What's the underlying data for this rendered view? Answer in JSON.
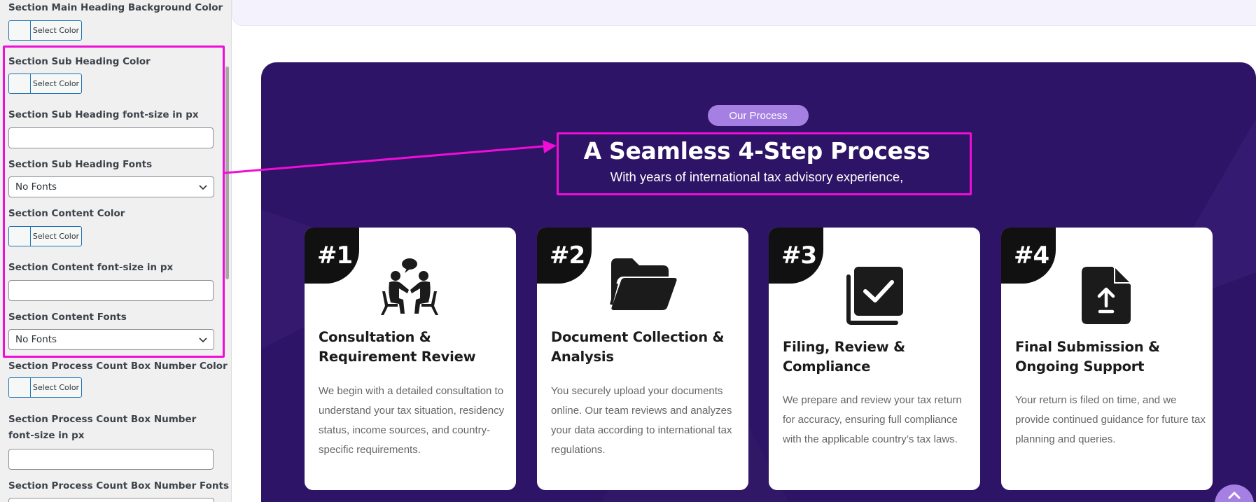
{
  "settings_panel": {
    "main_heading_bg_label": "Section Main Heading Background Color",
    "sub_heading_color_label": "Section Sub Heading Color",
    "sub_heading_font_size_label": "Section Sub Heading font-size in px",
    "sub_heading_fonts_label": "Section Sub Heading Fonts",
    "content_color_label": "Section Content Color",
    "content_font_size_label": "Section Content font-size in px",
    "content_fonts_label": "Section Content Fonts",
    "count_box_number_color_label": "Section Process Count Box Number Color",
    "count_box_number_font_size_label": "Section Process Count Box Number font-size in px",
    "count_box_number_fonts_label": "Section Process Count Box Number Fonts",
    "select_color_label": "Select Color",
    "sub_heading_font_size_value": "",
    "content_font_size_value": "",
    "count_box_number_font_size_value": "",
    "sub_heading_fonts_value": "No Fonts",
    "content_fonts_value": "No Fonts"
  },
  "preview": {
    "badge": "Our Process",
    "heading": "A Seamless 4-Step Process",
    "subheading": "With years of international tax advisory experience,",
    "steps": [
      {
        "number": "#1",
        "icon": "consultation-icon",
        "title": "Consultation & Requirement Review",
        "text": "We begin with a detailed consultation to understand your tax situation, residency status, income sources, and country-specific requirements."
      },
      {
        "number": "#2",
        "icon": "folder-icon",
        "title": "Document Collection & Analysis",
        "text": "You securely upload your documents online. Our team reviews and analyzes your data according to international tax regulations."
      },
      {
        "number": "#3",
        "icon": "checkbox-stack-icon",
        "title": "Filing, Review & Compliance",
        "text": "We prepare and review your tax return for accuracy, ensuring full compliance with the applicable country’s tax laws."
      },
      {
        "number": "#4",
        "icon": "file-upload-icon",
        "title": "Final Submission & Ongoing Support",
        "text": "Your return is filed on time, and we provide continued guidance for future tax planning and queries."
      }
    ]
  },
  "colors": {
    "highlight": "#f00dd6",
    "section_bg": "#2d1466",
    "badge_bg": "#a57fe2",
    "count_box_bg": "#111111",
    "panel_bg": "#f0f0f1",
    "link_blue": "#2271b1"
  }
}
